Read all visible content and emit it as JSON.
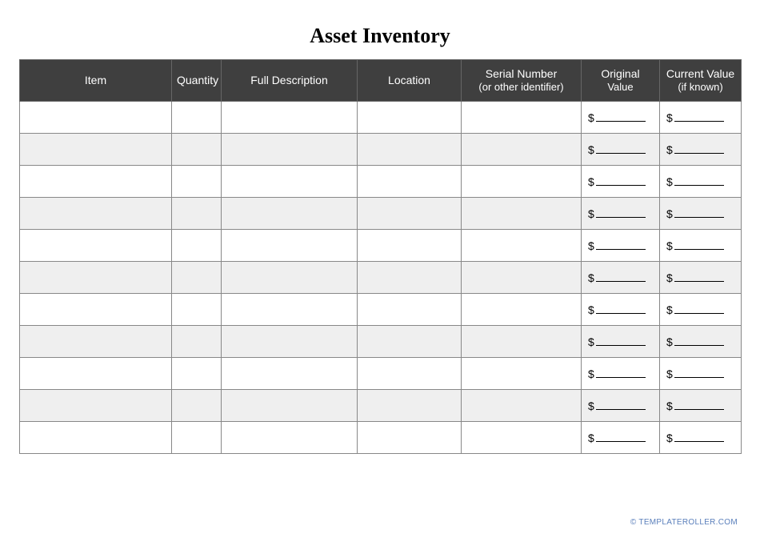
{
  "title": "Asset Inventory",
  "columns": {
    "item": "Item",
    "quantity": "Quantity",
    "full_description": "Full Description",
    "location": "Location",
    "serial_number_main": "Serial Number",
    "serial_number_sub": "(or other identifier)",
    "original_value_main": "Original",
    "original_value_sub": "Value",
    "current_value_main": "Current Value",
    "current_value_sub": "(if known)"
  },
  "currency_symbol": "$",
  "row_count": 11,
  "rows": [
    {
      "item": "",
      "quantity": "",
      "description": "",
      "location": "",
      "serial": "",
      "original": "",
      "current": ""
    },
    {
      "item": "",
      "quantity": "",
      "description": "",
      "location": "",
      "serial": "",
      "original": "",
      "current": ""
    },
    {
      "item": "",
      "quantity": "",
      "description": "",
      "location": "",
      "serial": "",
      "original": "",
      "current": ""
    },
    {
      "item": "",
      "quantity": "",
      "description": "",
      "location": "",
      "serial": "",
      "original": "",
      "current": ""
    },
    {
      "item": "",
      "quantity": "",
      "description": "",
      "location": "",
      "serial": "",
      "original": "",
      "current": ""
    },
    {
      "item": "",
      "quantity": "",
      "description": "",
      "location": "",
      "serial": "",
      "original": "",
      "current": ""
    },
    {
      "item": "",
      "quantity": "",
      "description": "",
      "location": "",
      "serial": "",
      "original": "",
      "current": ""
    },
    {
      "item": "",
      "quantity": "",
      "description": "",
      "location": "",
      "serial": "",
      "original": "",
      "current": ""
    },
    {
      "item": "",
      "quantity": "",
      "description": "",
      "location": "",
      "serial": "",
      "original": "",
      "current": ""
    },
    {
      "item": "",
      "quantity": "",
      "description": "",
      "location": "",
      "serial": "",
      "original": "",
      "current": ""
    },
    {
      "item": "",
      "quantity": "",
      "description": "",
      "location": "",
      "serial": "",
      "original": "",
      "current": ""
    }
  ],
  "footer": {
    "copyright": "©",
    "site": "TEMPLATEROLLER.COM"
  }
}
